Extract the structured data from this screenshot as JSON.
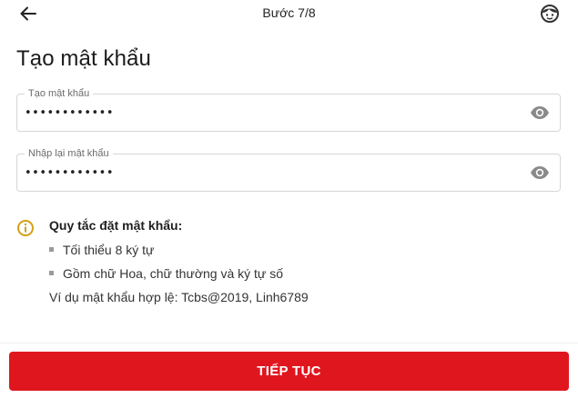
{
  "header": {
    "back_icon": "arrow-left-icon",
    "step_label": "Bước 7/8",
    "support_icon": "support-agent-icon"
  },
  "page_title": "Tạo mật khẩu",
  "fields": {
    "password": {
      "label": "Tạo mật khẩu",
      "value": "••••••••••••",
      "toggle_icon": "eye-icon"
    },
    "confirm_password": {
      "label": "Nhập lại mật khẩu",
      "value": "••••••••••••",
      "toggle_icon": "eye-icon"
    }
  },
  "rules": {
    "icon": "info-icon",
    "title": "Quy tắc đặt mật khẩu:",
    "items": [
      "Tối thiểu 8 ký tự",
      "Gồm chữ Hoa, chữ thường và ký tự số"
    ],
    "example": "Ví dụ mật khẩu hợp lệ: Tcbs@2019, Linh6789"
  },
  "footer": {
    "continue_label": "TIẾP TỤC"
  },
  "colors": {
    "primary": "#e0161f",
    "info_icon": "#d4a017",
    "border": "#d6d6d6"
  }
}
